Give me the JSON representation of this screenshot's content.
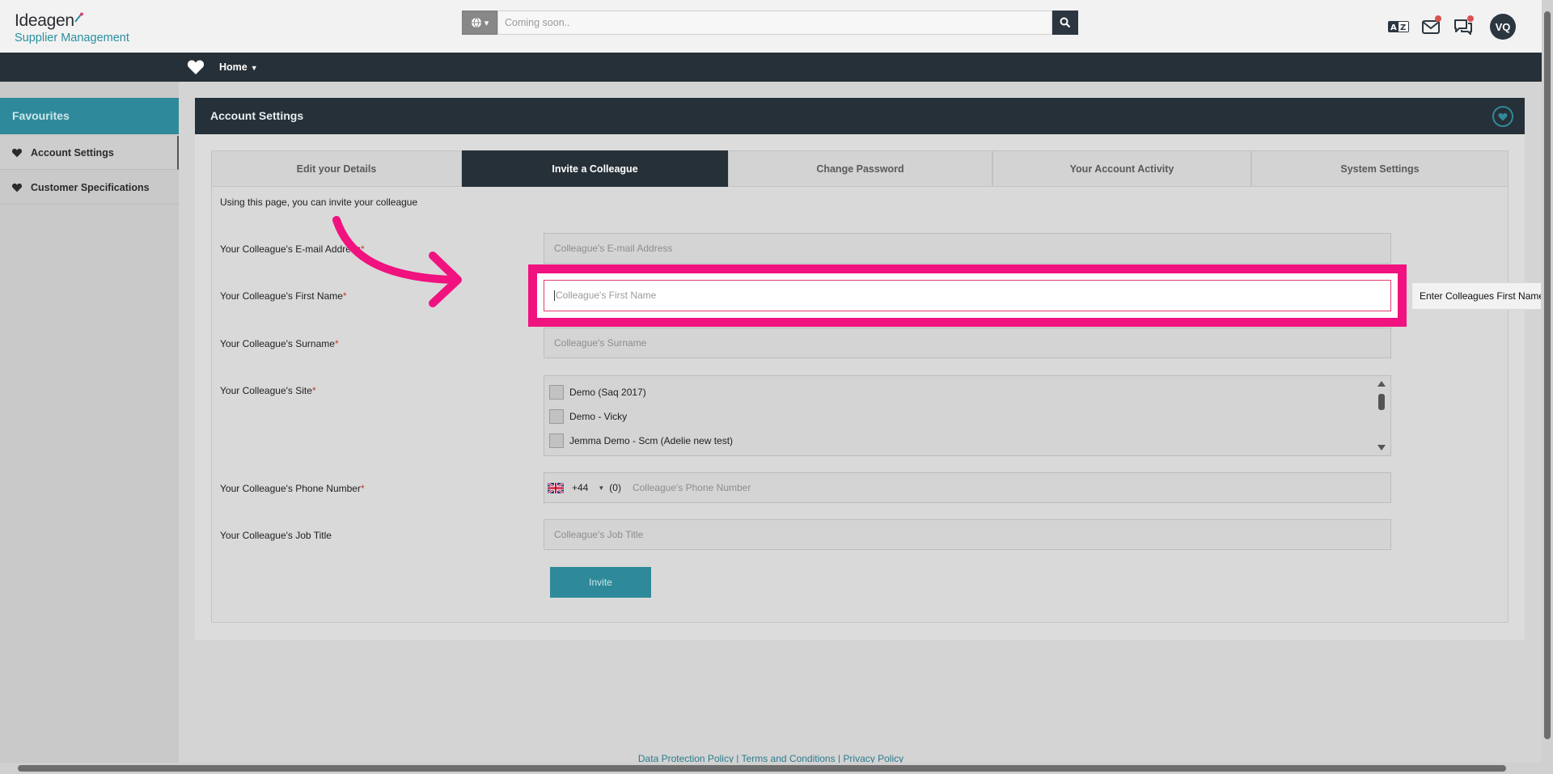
{
  "header": {
    "logo_line1": "Ideagen",
    "logo_line2": "Supplier Management",
    "search_placeholder": "Coming soon..",
    "avatar_initials": "VQ"
  },
  "nav": {
    "home_label": "Home"
  },
  "sidebar": {
    "title": "Favourites",
    "items": [
      {
        "label": "Account Settings"
      },
      {
        "label": "Customer Specifications"
      }
    ]
  },
  "panel": {
    "title": "Account Settings",
    "tabs": [
      {
        "label": "Edit your Details"
      },
      {
        "label": "Invite a Colleague"
      },
      {
        "label": "Change Password"
      },
      {
        "label": "Your Account Activity"
      },
      {
        "label": "System Settings"
      }
    ],
    "intro": "Using this page, you can invite your colleague"
  },
  "form": {
    "email_label": "Your Colleague's E-mail Address",
    "email_placeholder": "Colleague's E-mail Address",
    "first_name_label": "Your Colleague's First Name",
    "first_name_placeholder": "Colleague's First Name",
    "first_name_tooltip": "Enter Colleagues First Name",
    "surname_label": "Your Colleague's Surname",
    "surname_placeholder": "Colleague's Surname",
    "site_label": "Your Colleague's Site",
    "sites": [
      "Demo (Saq 2017)",
      "Demo - Vicky",
      "Jemma Demo - Scm (Adelie new test)"
    ],
    "phone_label": "Your Colleague's Phone Number",
    "phone_code": "+44",
    "phone_zero": "(0)",
    "phone_placeholder": "Colleague's Phone Number",
    "job_label": "Your Colleague's Job Title",
    "job_placeholder": "Colleague's Job Title",
    "invite_button": "Invite",
    "required_mark": "*"
  },
  "footer": {
    "link1": "Data Protection Policy",
    "link2": "Terms and Conditions",
    "link3": "Privacy Policy",
    "separator": "|"
  },
  "colors": {
    "highlight": "#f0127f",
    "accent": "#2e8a9a",
    "dark": "#263038"
  }
}
